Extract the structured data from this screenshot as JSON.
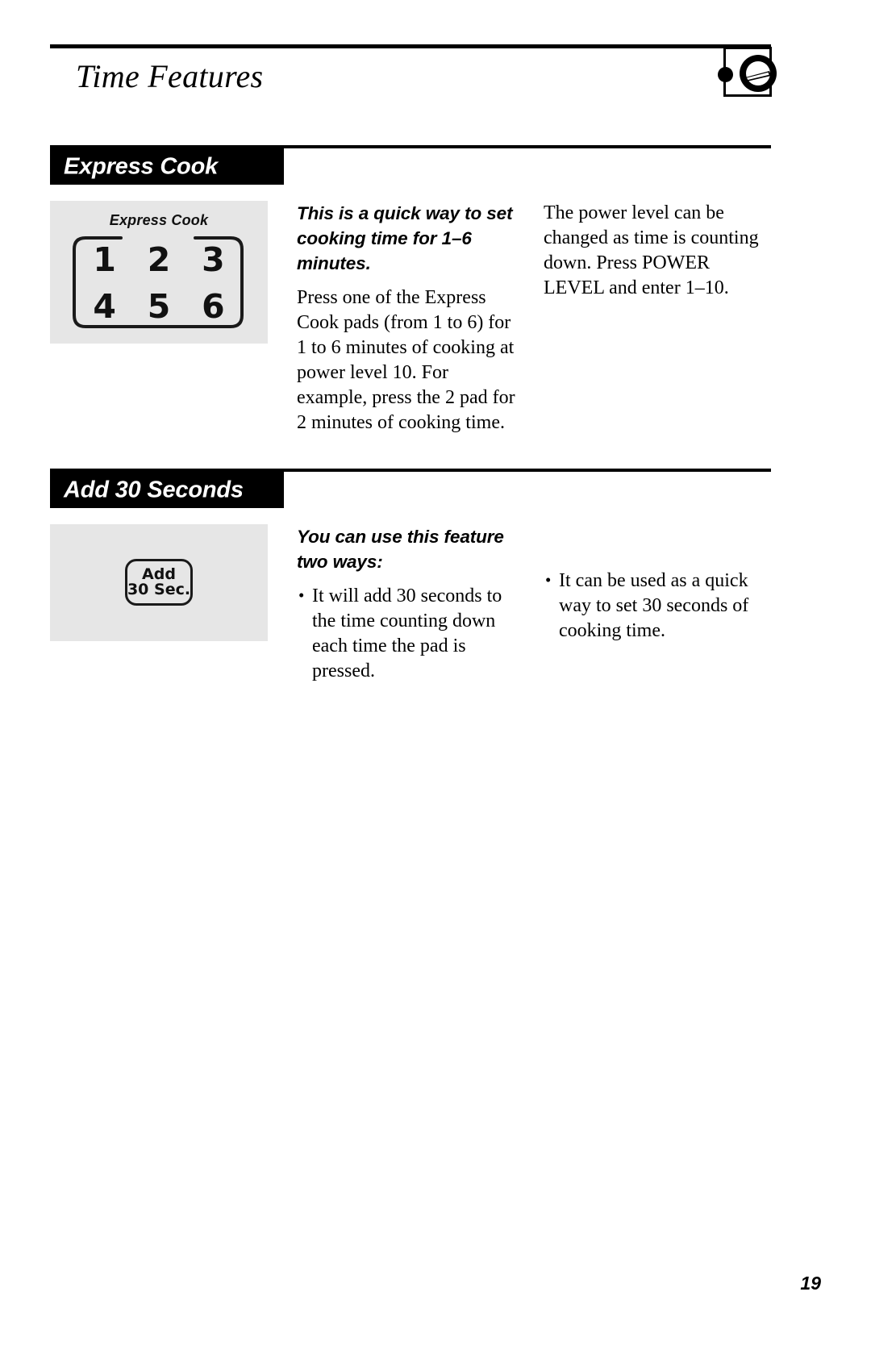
{
  "header": {
    "title": "Time Features",
    "icon": "control-knob-icon"
  },
  "sections": [
    {
      "id": "express-cook",
      "bar_label": "Express Cook",
      "panel": {
        "type": "keypad",
        "label": "Express Cook",
        "digits": [
          "1",
          "2",
          "3",
          "4",
          "5",
          "6"
        ]
      },
      "middle_column": {
        "lead": "This is a quick way to set cooking time for 1–6 minutes.",
        "paragraph": "Press one of the Express Cook pads (from 1 to 6) for 1 to 6 minutes of cooking at power level 10. For example, press the 2 pad for 2 minutes of cooking time."
      },
      "right_column": {
        "paragraph": "The power level can be changed as time is counting down. Press POWER LEVEL and enter 1–10."
      }
    },
    {
      "id": "add-30-seconds",
      "bar_label": "Add 30 Seconds",
      "panel": {
        "type": "pad-button",
        "button_line_1": "Add",
        "button_line_2": "30 Sec."
      },
      "middle_column": {
        "lead": "You can use this feature two ways:",
        "bullets": [
          "It will add 30 seconds to the time counting down each time the pad is pressed."
        ]
      },
      "right_column": {
        "bullets": [
          "It can be used as a quick way to set 30 seconds of cooking time."
        ]
      }
    }
  ],
  "footer": {
    "page_number": "19"
  },
  "colors": {
    "bar_background": "#000000",
    "bar_text": "#ffffff",
    "panel_background": "#e6e6e6",
    "text": "#000000"
  }
}
